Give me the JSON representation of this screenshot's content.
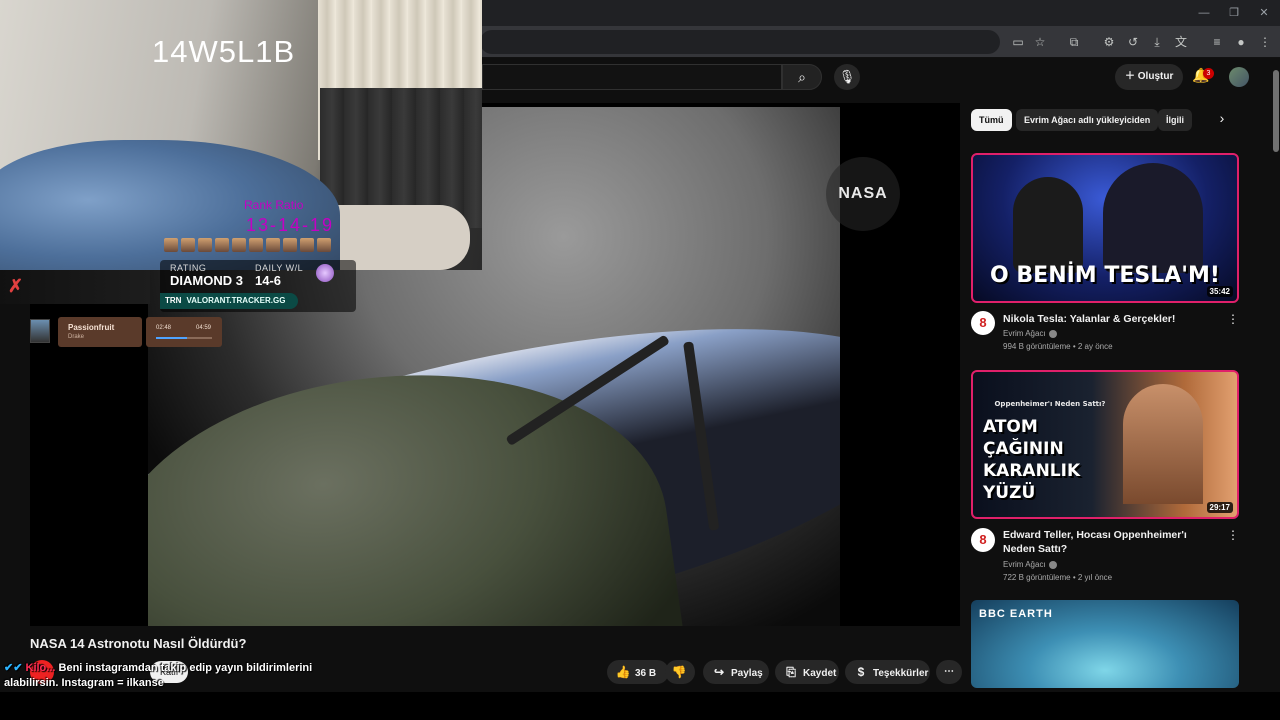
{
  "browser": {
    "window_controls": {
      "minimize": "—",
      "restore": "❐",
      "close": "✕"
    }
  },
  "header": {
    "create_label": "Oluştur",
    "notification_count": "3"
  },
  "player": {
    "watermark": "NASA"
  },
  "stream_overlay": {
    "cam_code": "14W5L1B",
    "rank_label": "Rank Ratio",
    "rank_score": "13-14-19",
    "rating_label": "RATING",
    "rating_value": "DIAMOND 3",
    "daily_label": "DAILY W/L",
    "daily_value": "14-6",
    "trn_tag": "TRN",
    "trn_site": "VALORANT.TRACKER.GG",
    "now_playing": {
      "title": "Passionfruit",
      "artist": "Drake",
      "elapsed": "02:48",
      "total": "04:59",
      "progress": 0.56
    },
    "chat": {
      "user": "Kilo...",
      "text": "Beni instagramdan takip edip yayın bildirimlerini alabilirsin. Instagram = ilkanse"
    }
  },
  "video": {
    "title": "NASA 14 Astronotu Nasıl Öldürdü?",
    "join_label": "Katıl",
    "likes": "36 B",
    "share_label": "Paylaş",
    "save_label": "Kaydet",
    "thanks_label": "Teşekkürler"
  },
  "sidebar": {
    "chips": [
      "Tümü",
      "Evrim Ağacı adlı yükleyiciden",
      "İlgili"
    ],
    "videos": [
      {
        "title": "Nikola Tesla: Yalanlar & Gerçekler!",
        "channel": "Evrim Ağacı",
        "meta": "994 B görüntüleme • 2 ay önce",
        "duration": "35:42",
        "thumb_text": "O BENİM TESLA'M!"
      },
      {
        "title": "Edward Teller, Hocası Oppenheimer'ı Neden Sattı?",
        "channel": "Evrim Ağacı",
        "meta": "722 B görüntüleme • 2 yıl önce",
        "duration": "29:17",
        "thumb_small": "Oppenheimer'ı Neden Sattı?",
        "thumb_text": "ATOM ÇAĞININ KARANLIK YÜZÜ"
      },
      {
        "brand": "BBC EARTH"
      }
    ]
  },
  "colors": {
    "accent_red": "#cc0000",
    "thumb_border": "#e0206a",
    "trn_green": "#0b4a45"
  }
}
